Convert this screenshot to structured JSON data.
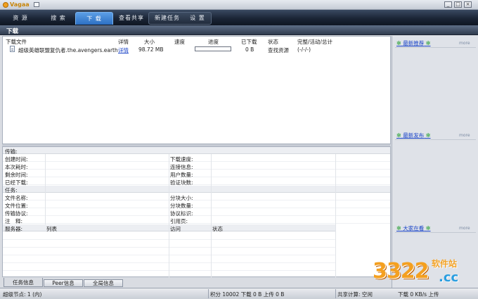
{
  "app": {
    "name": "Vagaa"
  },
  "window_buttons": {
    "min": "_",
    "max": "□",
    "close": "×"
  },
  "nav": {
    "tabs": [
      {
        "label": "资 源"
      },
      {
        "label": "搜 索"
      },
      {
        "label": "下 载"
      },
      {
        "label": "查看共享"
      }
    ],
    "new_task": "新建任务",
    "settings": "设 置"
  },
  "section_title": "下载",
  "downloads": {
    "columns": [
      "下载文件",
      "详情",
      "大小",
      "速度",
      "进度",
      "已下载",
      "状态",
      "完整/活动/总计"
    ],
    "rows": [
      {
        "file": "超级英雄联盟复仇者.the.avengers.earth",
        "details": "详情",
        "size": "98.72 MB",
        "speed": "",
        "progress": 0,
        "downloaded": "0 B",
        "status": "查找资源",
        "peers": "(-/-/-)"
      }
    ]
  },
  "details": {
    "transfer_header": "传输:",
    "transfer_left": [
      "创建时间:",
      "本次耗时:",
      "剩余时间:",
      "已经下载:"
    ],
    "transfer_right": [
      "下载速度:",
      "连接信息:",
      "用户数量:",
      "验证块数:"
    ],
    "task_header": "任务:",
    "task_left": [
      "文件名称:",
      "文件位置:",
      "传输协议:",
      "注　释:"
    ],
    "task_right": [
      "分块大小:",
      "分块数量:",
      "协议标识:",
      "引用页:"
    ],
    "server_columns": [
      "服务器:",
      "列表",
      "访问",
      "状态"
    ]
  },
  "bottom_tabs": [
    "任务信息",
    "Peer信息",
    "全局信息"
  ],
  "status": {
    "super_nodes": "超级节点: 1 (内)",
    "points": "积分 10002 下载 0 B 上传 0 B",
    "shared_calc": "共享计算: 空闲",
    "speeds": "下载 0 KB/s 上传"
  },
  "right_panel": {
    "blocks": [
      {
        "title": "最新推荐",
        "more": "more"
      },
      {
        "title": "最新发布",
        "more": "more"
      },
      {
        "title": "大家在看",
        "more": "more"
      }
    ]
  },
  "watermark": {
    "big": "3322",
    "small": "软件站",
    "cc": ".cc"
  }
}
